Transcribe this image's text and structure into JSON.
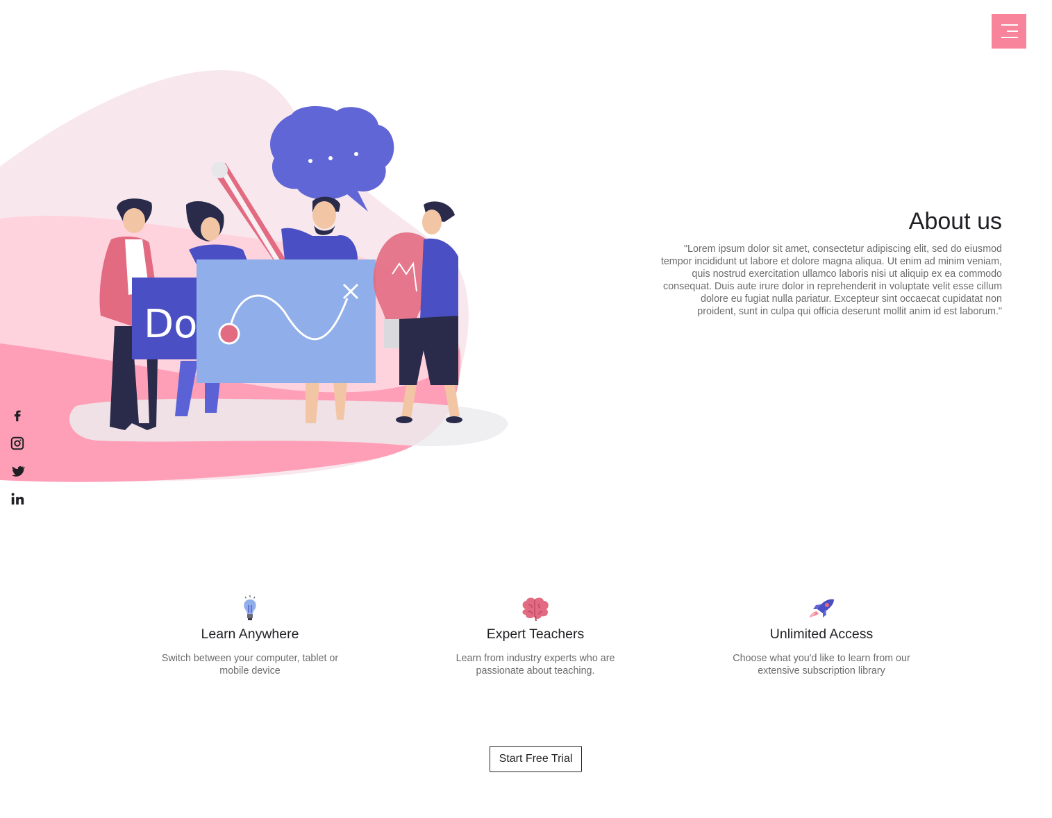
{
  "header": {
    "menu_icon": "hamburger-menu-icon",
    "menu_color": "#f7849a"
  },
  "hero": {
    "illustration": "team-collaboration-illustration",
    "board_text": "Do!"
  },
  "social": [
    {
      "name": "facebook-icon"
    },
    {
      "name": "instagram-icon"
    },
    {
      "name": "twitter-icon"
    },
    {
      "name": "linkedin-icon"
    }
  ],
  "about": {
    "title": "About us",
    "text": "\"Lorem ipsum dolor sit amet, consectetur adipiscing elit, sed do eiusmod tempor incididunt ut labore et dolore magna aliqua. Ut enim ad minim veniam, quis nostrud exercitation ullamco laboris nisi ut aliquip ex ea commodo consequat. Duis aute irure dolor in reprehenderit in voluptate velit esse cillum dolore eu fugiat nulla pariatur. Excepteur sint occaecat cupidatat non proident, sunt in culpa qui officia deserunt mollit anim id est laborum.\""
  },
  "features": [
    {
      "icon": "lightbulb-icon",
      "title": "Learn Anywhere",
      "text": "Switch between your computer, tablet or mobile device"
    },
    {
      "icon": "brain-icon",
      "title": "Expert Teachers",
      "text": "Learn from industry experts who are passionate about teaching."
    },
    {
      "icon": "rocket-icon",
      "title": "Unlimited Access",
      "text": "Choose what you'd like to learn from our extensive subscription library"
    }
  ],
  "cta": {
    "label": "Start Free Trial"
  },
  "colors": {
    "accent": "#f7849a",
    "pink": "#ff9fb7",
    "blue": "#5c63d6",
    "light_blue": "#8faeea"
  }
}
